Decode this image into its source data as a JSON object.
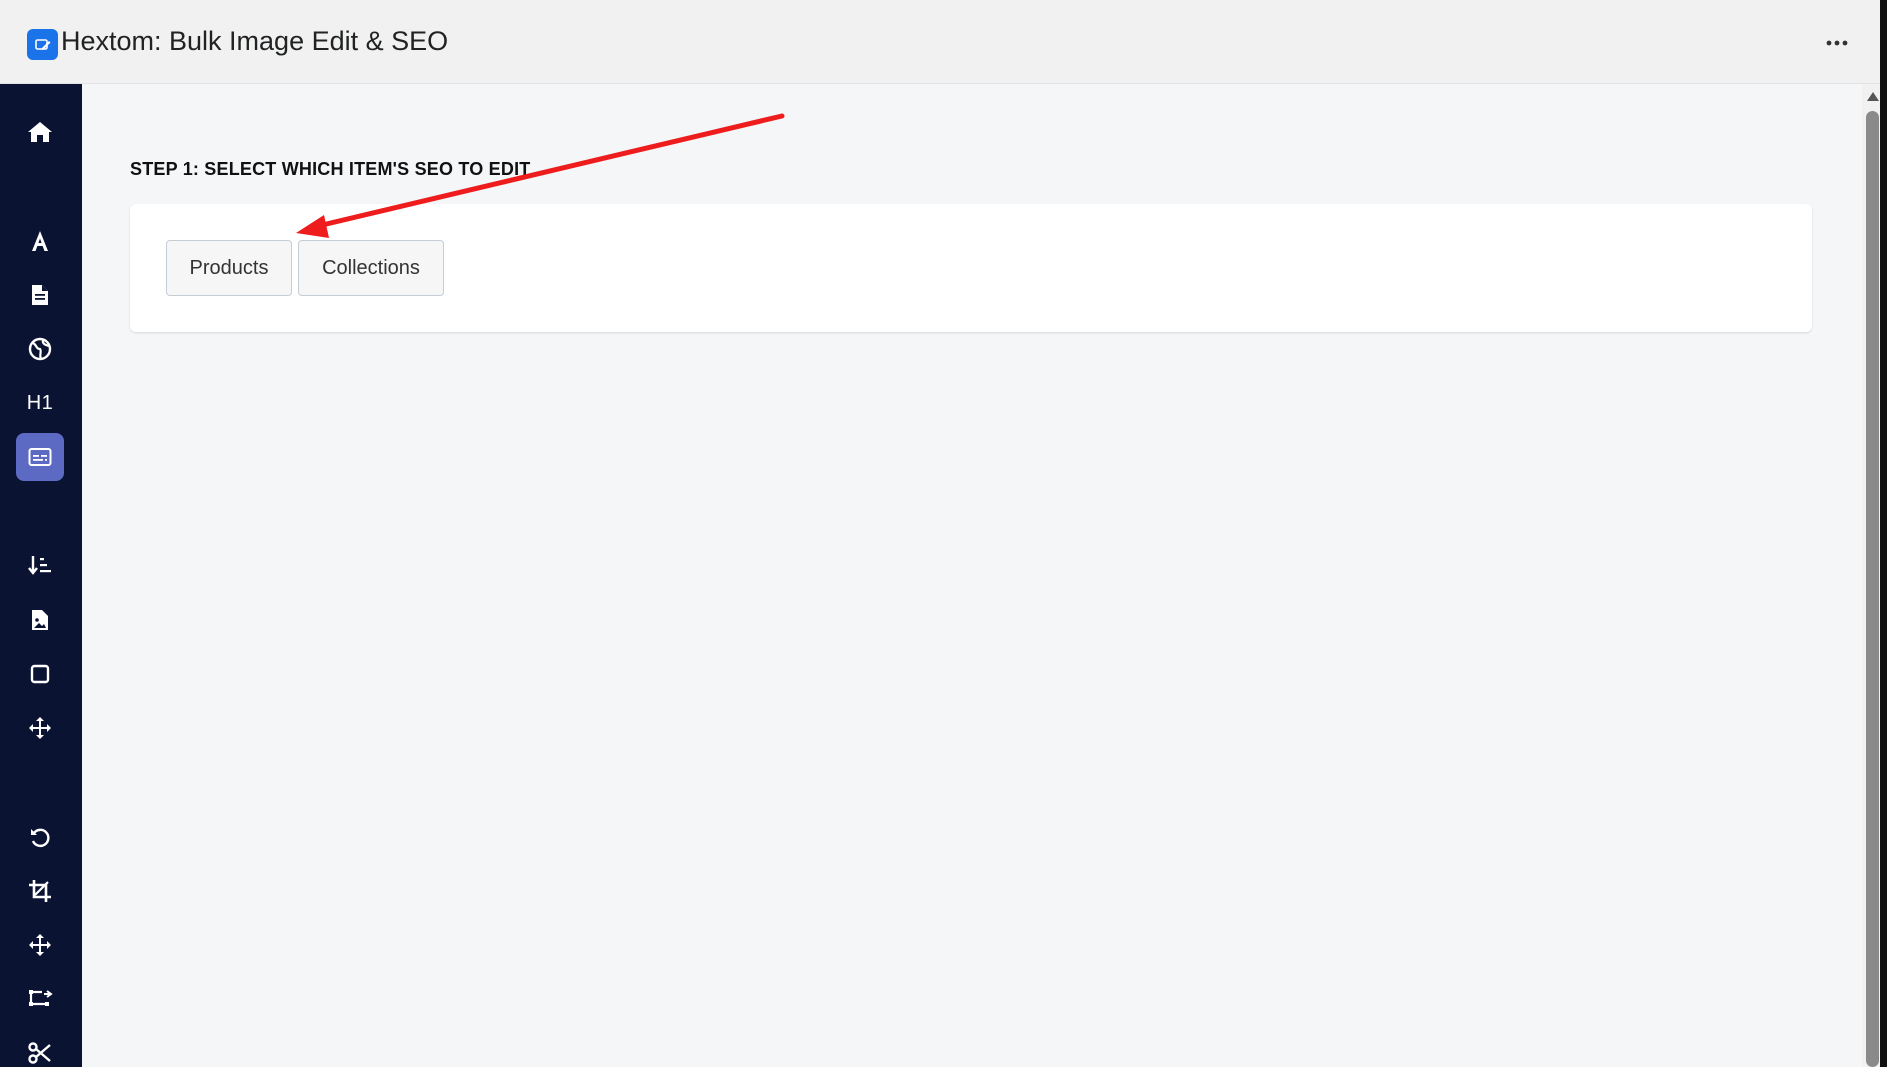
{
  "app": {
    "title": "Hextom: Bulk Image Edit & SEO",
    "logo_color": "#1a73e8",
    "more_icon": "more-horizontal-icon"
  },
  "sidebar": {
    "background": "#0b1333",
    "active_color": "#5c6ac4",
    "items": [
      {
        "icon": "home-icon",
        "active": false
      },
      {
        "icon": "font-icon",
        "active": false
      },
      {
        "icon": "file-icon",
        "active": false
      },
      {
        "icon": "globe-icon",
        "active": false
      },
      {
        "icon": "heading-icon",
        "label": "H1",
        "active": false
      },
      {
        "icon": "closed-caption-icon",
        "active": true
      },
      {
        "icon": "sort-icon",
        "active": false
      },
      {
        "icon": "file-image-icon",
        "active": false
      },
      {
        "icon": "square-icon",
        "active": false
      },
      {
        "icon": "move-icon",
        "active": false
      },
      {
        "icon": "undo-icon",
        "active": false
      },
      {
        "icon": "crop-icon",
        "active": false
      },
      {
        "icon": "move-icon",
        "active": false
      },
      {
        "icon": "resize-icon",
        "active": false
      },
      {
        "icon": "scissors-icon",
        "active": false
      }
    ]
  },
  "main": {
    "step_title": "STEP 1: SELECT WHICH ITEM'S SEO TO EDIT",
    "buttons": {
      "products": "Products",
      "collections": "Collections"
    }
  },
  "annotation": {
    "arrow_color": "#ee1c1c",
    "arrow_icon": "arrow-annotation"
  }
}
